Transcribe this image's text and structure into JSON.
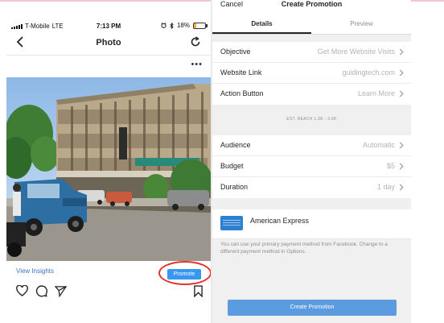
{
  "left_phone": {
    "status_bar": {
      "carrier": "T-Mobile",
      "network": "LTE",
      "time": "7:13 PM",
      "battery": "18%",
      "battery_level": 0.18
    },
    "navbar": {
      "title": "Photo",
      "back_icon": "chevron-left-icon",
      "refresh_icon": "refresh-icon"
    },
    "more_label": "•••",
    "insights_label": "View Insights",
    "promote_label": "Promote",
    "actions": [
      "heart-icon",
      "comment-icon",
      "share-icon",
      "bookmark-icon"
    ],
    "colors": {
      "link": "#3b73c8",
      "promote": "#3897f0",
      "highlight": "#e2322a"
    }
  },
  "right_phone": {
    "header": {
      "cancel_label": "Cancel",
      "title": "Create Promotion"
    },
    "tabs": [
      {
        "label": "Details",
        "active": true
      },
      {
        "label": "Preview",
        "active": false
      }
    ],
    "rows_top": [
      {
        "label": "Objective",
        "value": "Get More Website Visits"
      },
      {
        "label": "Website Link",
        "value": "guidingtech.com"
      },
      {
        "label": "Action Button",
        "value": "Learn More"
      }
    ],
    "reach_text": "EST. REACH 1.3K - 3.6K",
    "rows_bottom": [
      {
        "label": "Audience",
        "value": "Automatic"
      },
      {
        "label": "Budget",
        "value": "$5"
      },
      {
        "label": "Duration",
        "value": "1 day"
      }
    ],
    "payment": {
      "method": "American Express",
      "note": "You can use your primary payment method from Facebook. Change to a different payment method in Options."
    },
    "create_button": "Create Promotion",
    "colors": {
      "button": "#5b9be0",
      "amex": "#2f7fd1"
    }
  }
}
